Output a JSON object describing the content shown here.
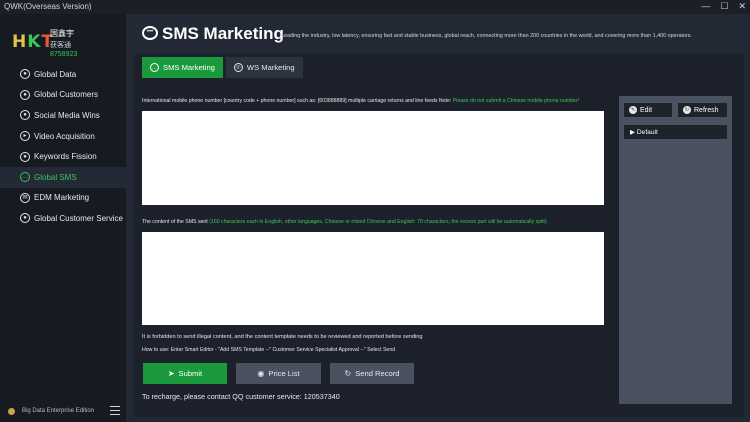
{
  "window": {
    "title": "QWK(Overseas Version)",
    "minimize": "—",
    "maximize": "☐",
    "close": "✕"
  },
  "brand": {
    "logo_h": "H",
    "logo_k": "K",
    "logo_t": "T",
    "line1": "国鑫宇",
    "line2": "获客通",
    "number": "8758923"
  },
  "sidebar": {
    "items": [
      {
        "label": "Global Data",
        "icon": "globe-icon"
      },
      {
        "label": "Global Customers",
        "icon": "users-icon"
      },
      {
        "label": "Social Media Wins",
        "icon": "share-icon"
      },
      {
        "label": "Video Acquisition",
        "icon": "video-icon"
      },
      {
        "label": "Keywords Fission",
        "icon": "key-icon"
      },
      {
        "label": "Global SMS",
        "icon": "sms-icon",
        "active": true
      },
      {
        "label": "EDM Marketing",
        "icon": "mail-icon"
      },
      {
        "label": "Global Customer Service",
        "icon": "headset-icon"
      }
    ],
    "footer": "Big Data Enterprise Edition"
  },
  "header": {
    "title": "SMS Marketing",
    "subtitle": "Leading the industry, low latency, ensuring fast and stable business, global reach, connecting more than 200 countries in the world, and covering more than 1,400 operators."
  },
  "tabs": [
    {
      "label": "SMS Marketing",
      "active": true
    },
    {
      "label": "WS Marketing",
      "active": false
    }
  ],
  "form": {
    "phone_label": "International mobile phone number [country code + phone number] such as: [603888889] multiple carriage returns and line feeds Note:",
    "phone_note": "Please do not submit a Chinese mobile phone number!",
    "phone_value": "",
    "content_label": "The content of the SMS sent",
    "content_note": "(160 characters each in English, other languages, Chinese or mixed Chinese and English: 70 characters, the excess part will be automatically split)",
    "content_value": "",
    "warning": "It is forbidden to send illegal content, and the content template needs to be reviewed and reported before sending",
    "howto": "How to use: Enter Smart Editor - \"Add SMS Template --\" Customer Service Specialist Approval --\" Select Send",
    "recharge": "To recharge, please contact QQ customer service: 120537340"
  },
  "buttons": {
    "submit": "Submit",
    "price": "Price List",
    "record": "Send Record"
  },
  "right_panel": {
    "edit": "Edit",
    "refresh": "Refresh",
    "default_item": "Default"
  },
  "colors": {
    "accent": "#1a9a3c",
    "active_text": "#3ec45a"
  }
}
